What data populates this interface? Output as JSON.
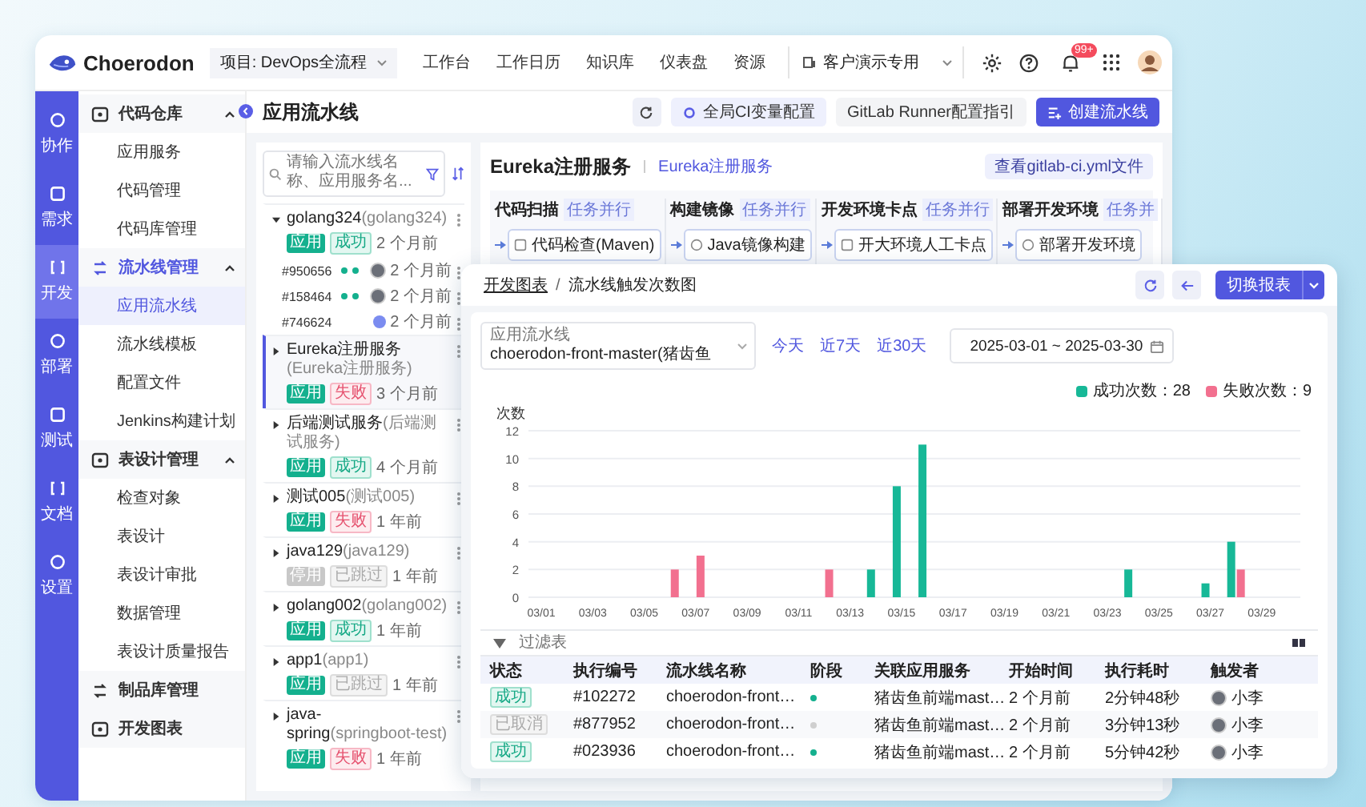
{
  "topbar": {
    "logo": "Choerodon",
    "project": "项目: DevOps全流程",
    "nav": [
      "工作台",
      "工作日历",
      "知识库",
      "仪表盘",
      "资源"
    ],
    "org": "客户演示专用",
    "badge": "99+"
  },
  "rail": [
    {
      "label": "协作",
      "selected": false
    },
    {
      "label": "需求",
      "selected": false
    },
    {
      "label": "开发",
      "selected": true
    },
    {
      "label": "部署",
      "selected": false
    },
    {
      "label": "测试",
      "selected": false
    },
    {
      "label": "文档",
      "selected": false
    },
    {
      "label": "设置",
      "selected": false
    }
  ],
  "menu": [
    {
      "label": "代码仓库",
      "kind": "group",
      "expanded": true,
      "active": false,
      "children": [
        {
          "label": "应用服务",
          "selected": false
        },
        {
          "label": "代码管理",
          "selected": false
        },
        {
          "label": "代码库管理",
          "selected": false
        }
      ]
    },
    {
      "label": "流水线管理",
      "kind": "group",
      "expanded": true,
      "active": true,
      "children": [
        {
          "label": "应用流水线",
          "selected": true
        },
        {
          "label": "流水线模板",
          "selected": false
        },
        {
          "label": "配置文件",
          "selected": false
        },
        {
          "label": "Jenkins构建计划",
          "selected": false
        }
      ]
    },
    {
      "label": "表设计管理",
      "kind": "group",
      "expanded": true,
      "active": false,
      "children": [
        {
          "label": "检查对象",
          "selected": false
        },
        {
          "label": "表设计",
          "selected": false
        },
        {
          "label": "表设计审批",
          "selected": false
        },
        {
          "label": "数据管理",
          "selected": false
        },
        {
          "label": "表设计质量报告",
          "selected": false
        }
      ]
    },
    {
      "label": "制品库管理",
      "kind": "link"
    },
    {
      "label": "开发图表",
      "kind": "link"
    }
  ],
  "page": {
    "title": "应用流水线",
    "buttons": [
      {
        "label": "全局CI变量配置",
        "kind": "secondary"
      },
      {
        "label": "GitLab Runner配置指引",
        "kind": "plain"
      },
      {
        "label": "创建流水线",
        "kind": "primary"
      }
    ]
  },
  "pipelines": {
    "search_placeholder": "请输入流水线名称、应用服务名...",
    "items": [
      {
        "name": "golang324",
        "code": "(golang324)",
        "type_tag": "应用",
        "enabled": true,
        "status": {
          "label": "成功",
          "kind": "success"
        },
        "time": "2 个月前",
        "expanded": true,
        "selected": false,
        "runs": [
          {
            "id": "#950656",
            "stages": [
              {
                "color": "#14b08e"
              },
              {
                "color": "#14b08e"
              }
            ],
            "avatar": {
              "kind": "photo"
            },
            "time": "2 个月前"
          },
          {
            "id": "#158464",
            "stages": [
              {
                "color": "#14b08e"
              },
              {
                "color": "#14b08e"
              }
            ],
            "avatar": {
              "kind": "photo"
            },
            "time": "2 个月前"
          },
          {
            "id": "#746624",
            "avatar": {
              "kind": "system"
            },
            "time": "2 个月前"
          }
        ]
      },
      {
        "name": "Eureka注册服务",
        "code": "(Eureka注册服务)",
        "type_tag": "应用",
        "enabled": true,
        "status": {
          "label": "失败",
          "kind": "failed"
        },
        "time": "3 个月前",
        "expanded": false,
        "selected": true
      },
      {
        "name": "后端测试服务",
        "code": "(后端测试服务)",
        "type_tag": "应用",
        "enabled": true,
        "status": {
          "label": "成功",
          "kind": "success"
        },
        "time": "4 个月前",
        "expanded": false,
        "selected": false
      },
      {
        "name": "测试005",
        "code": "(测试005)",
        "type_tag": "应用",
        "enabled": true,
        "status": {
          "label": "失败",
          "kind": "failed"
        },
        "time": "1 年前",
        "expanded": false,
        "selected": false
      },
      {
        "name": "java129",
        "code": "(java129)",
        "type_tag": "停用",
        "enabled": false,
        "status": {
          "label": "已跳过",
          "kind": "skipped"
        },
        "time": "1 年前",
        "expanded": false,
        "selected": false
      },
      {
        "name": "golang002",
        "code": "(golang002)",
        "type_tag": "应用",
        "enabled": true,
        "status": {
          "label": "成功",
          "kind": "success"
        },
        "time": "1 年前",
        "expanded": false,
        "selected": false
      },
      {
        "name": "app1",
        "code": "(app1)",
        "type_tag": "应用",
        "enabled": true,
        "status": {
          "label": "已跳过",
          "kind": "skipped"
        },
        "time": "1 年前",
        "expanded": false,
        "selected": false
      },
      {
        "name": "java-spring",
        "code": "(springboot-test)",
        "type_tag": "应用",
        "enabled": true,
        "status": {
          "label": "失败",
          "kind": "failed"
        },
        "time": "1 年前",
        "expanded": false,
        "selected": false
      }
    ]
  },
  "detail": {
    "title": "Eureka注册服务",
    "link": "Eureka注册服务",
    "file_button": "查看gitlab-ci.yml文件",
    "stages": [
      {
        "name": "代码扫描",
        "tag": "任务并行",
        "job": "代码检查(Maven)"
      },
      {
        "name": "构建镜像",
        "tag": "任务并行",
        "job": "Java镜像构建"
      },
      {
        "name": "开发环境卡点",
        "tag": "任务并行",
        "job": "开大环境人工卡点"
      },
      {
        "name": "部署开发环境",
        "tag": "任务并",
        "job": "部署开发环境"
      }
    ]
  },
  "report": {
    "breadcrumb": [
      "开发图表",
      "流水线触发次数图"
    ],
    "breadcrumb_separator": "/",
    "switch_button": "切换报表",
    "select_label": "应用流水线",
    "select_value": "choerodon-front-master(猪齿鱼",
    "ranges": [
      "今天",
      "近7天",
      "近30天"
    ],
    "date_range": "2025-03-01 ~ 2025-03-30",
    "chart_data": {
      "type": "bar",
      "ylabel": "次数",
      "grid": true,
      "categories": [
        "03/01",
        null,
        "03/03",
        null,
        "03/05",
        null,
        "03/07",
        null,
        "03/09",
        null,
        "03/11",
        null,
        "03/13",
        null,
        "03/15",
        null,
        "03/17",
        null,
        "03/19",
        null,
        "03/21",
        null,
        "03/23",
        null,
        "03/25",
        null,
        "03/27",
        null,
        "03/29",
        null
      ],
      "ylim": [
        0,
        12
      ],
      "yticks": [
        0,
        2,
        4,
        6,
        8,
        10,
        12
      ],
      "series": [
        {
          "name": "成功次数：28",
          "color": "#17b897",
          "values": [
            0,
            0,
            0,
            0,
            0,
            0,
            0,
            0,
            0,
            0,
            0,
            0,
            0,
            2,
            8,
            11,
            0,
            0,
            0,
            0,
            0,
            0,
            0,
            2,
            0,
            0,
            1,
            4,
            0,
            0
          ]
        },
        {
          "name": "失败次数：9",
          "color": "#f2708f",
          "values": [
            0,
            0,
            0,
            0,
            0,
            2,
            3,
            0,
            0,
            0,
            0,
            2,
            0,
            0,
            0,
            0,
            0,
            0,
            0,
            0,
            0,
            0,
            0,
            0,
            0,
            0,
            0,
            2,
            0,
            0
          ]
        }
      ]
    },
    "table": {
      "filter_placeholder": "过滤表",
      "columns": [
        "状态",
        "执行编号",
        "流水线名称",
        "阶段",
        "关联应用服务",
        "开始时间",
        "执行耗时",
        "触发者"
      ],
      "rows": [
        {
          "status": {
            "label": "成功",
            "kind": "success"
          },
          "id": "#102272",
          "pipeline": "choerodon-front…",
          "stage": {
            "color": "#14b08e"
          },
          "service": "猪齿鱼前端mast…",
          "start": "2 个月前",
          "duration": "2分钟48秒",
          "trigger": "小李"
        },
        {
          "status": {
            "label": "已取消",
            "kind": "skipped"
          },
          "id": "#877952",
          "pipeline": "choerodon-front…",
          "stage": {
            "color": "#cfcfcf"
          },
          "service": "猪齿鱼前端mast…",
          "start": "2 个月前",
          "duration": "3分钟13秒",
          "trigger": "小李"
        },
        {
          "status": {
            "label": "成功",
            "kind": "success"
          },
          "id": "#023936",
          "pipeline": "choerodon-front…",
          "stage": {
            "color": "#14b08e"
          },
          "service": "猪齿鱼前端mast…",
          "start": "2 个月前",
          "duration": "5分钟42秒",
          "trigger": "小李"
        }
      ]
    }
  }
}
